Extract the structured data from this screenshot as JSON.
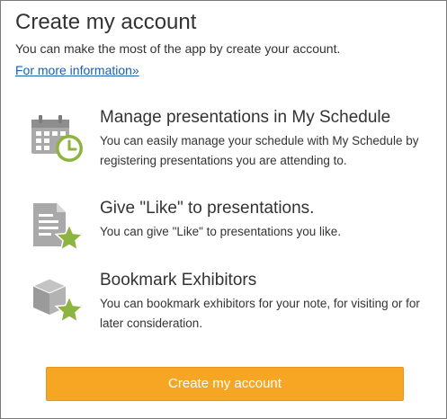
{
  "header": {
    "title": "Create my account",
    "subtitle": "You can make the most of the app by create your account.",
    "more_info_link": "For more information»"
  },
  "features": [
    {
      "icon": "calendar-clock-icon",
      "title": "Manage presentations in My Schedule",
      "description": "You can easily manage your schedule with My Schedule by registering presentations you are attending to."
    },
    {
      "icon": "document-star-icon",
      "title": "Give \"Like\" to presentations.",
      "description": "You can give \"Like\" to presentations you like."
    },
    {
      "icon": "box-star-icon",
      "title": "Bookmark Exhibitors",
      "description": "You can bookmark exhibitors for your note, for visiting or for later consideration."
    }
  ],
  "actions": {
    "create_account_label": "Create my account"
  },
  "colors": {
    "accent_button": "#f6a623",
    "icon_green": "#8db43e",
    "icon_gray": "#a7a7a7",
    "link": "#1a5fb4"
  }
}
